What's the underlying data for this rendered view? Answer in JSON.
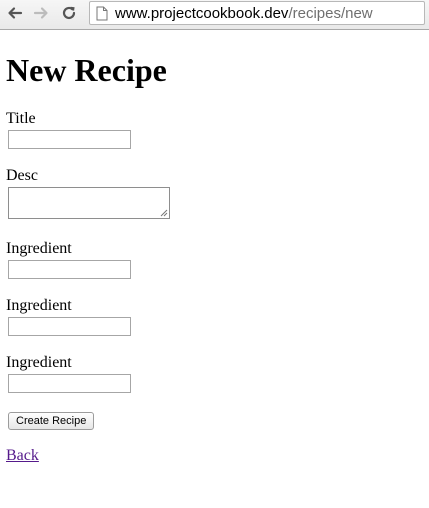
{
  "browser": {
    "url_host": "www.projectcookbook.dev",
    "url_path": "/recipes/new",
    "icons": [
      "back-arrow-icon",
      "forward-arrow-icon",
      "reload-icon",
      "page-icon"
    ]
  },
  "page": {
    "title": "New Recipe",
    "fields": {
      "title_label": "Title",
      "title_value": "",
      "desc_label": "Desc",
      "desc_value": "",
      "ingredient_1_label": "Ingredient",
      "ingredient_1_value": "",
      "ingredient_2_label": "Ingredient",
      "ingredient_2_value": "",
      "ingredient_3_label": "Ingredient",
      "ingredient_3_value": ""
    },
    "submit_label": "Create Recipe",
    "back_link": "Back"
  },
  "colors": {
    "link_visited": "#551a8b",
    "url_path": "#6f6f6f"
  }
}
